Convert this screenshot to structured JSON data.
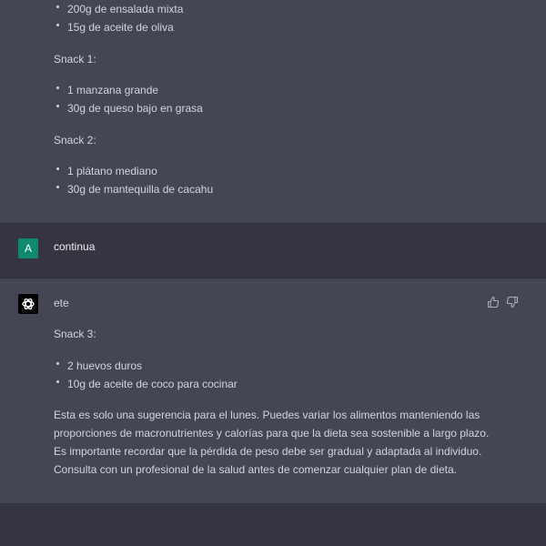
{
  "conversation": {
    "top_message": {
      "list_a": [
        "200g de ensalada mixta",
        "15g de aceite de oliva"
      ],
      "snack1_label": "Snack 1:",
      "snack1_items": [
        "1 manzana grande",
        "30g de queso bajo en grasa"
      ],
      "snack2_label": "Snack 2:",
      "snack2_items": [
        "1 plátano mediano",
        "30g de mantequilla de cacahu"
      ]
    },
    "user_message": {
      "avatar_letter": "A",
      "text": "continua"
    },
    "assistant_message": {
      "first_line": "ete",
      "snack3_label": "Snack 3:",
      "snack3_items": [
        "2 huevos duros",
        "10g de aceite de coco para cocinar"
      ],
      "paragraph": "Esta es solo una sugerencia para el lunes. Puedes variar los alimentos manteniendo las proporciones de macronutrientes y calorías para que la dieta sea sostenible a largo plazo. Es importante recordar que la pérdida de peso debe ser gradual y adaptada al individuo. Consulta con un profesional de la salud antes de comenzar cualquier plan de dieta."
    }
  },
  "colors": {
    "assistant_bg": "#444654",
    "user_bg": "#343541",
    "user_avatar": "#108a6e",
    "text": "#d1d5db"
  },
  "icons": {
    "assistant_avatar": "openai-logo-icon",
    "feedback": [
      "thumbs-up-icon",
      "thumbs-down-icon"
    ]
  }
}
